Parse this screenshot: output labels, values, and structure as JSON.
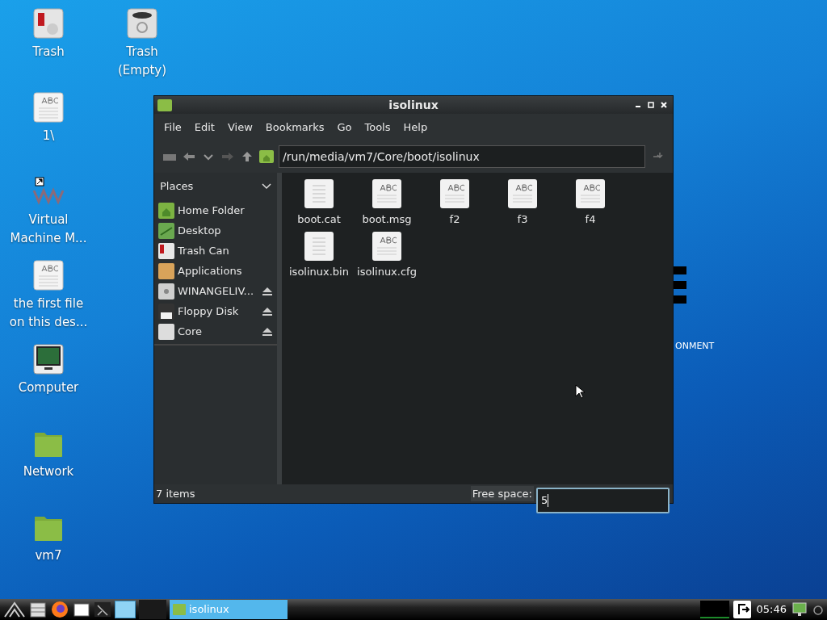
{
  "desktop_columns": [
    [
      {
        "label": "Trash",
        "kind": "trash-full"
      },
      {
        "label": "1\\",
        "kind": "text-file"
      },
      {
        "label": "Virtual\nMachine M...",
        "kind": "app"
      },
      {
        "label": "the first file\non this des...",
        "kind": "text-file"
      },
      {
        "label": "Computer",
        "kind": "computer"
      },
      {
        "label": "Network",
        "kind": "folder"
      },
      {
        "label": "vm7",
        "kind": "folder"
      }
    ],
    [
      {
        "label": "Trash\n(Empty)",
        "kind": "trash-empty"
      }
    ]
  ],
  "wallpaper_text": "ONMENT",
  "window": {
    "title": "isolinux",
    "menu": [
      "File",
      "Edit",
      "View",
      "Bookmarks",
      "Go",
      "Tools",
      "Help"
    ],
    "path": "/run/media/vm7/Core/boot/isolinux",
    "places_title": "Places",
    "places": [
      {
        "label": "Home Folder",
        "kind": "home",
        "eject": false
      },
      {
        "label": "Desktop",
        "kind": "desktop",
        "eject": false
      },
      {
        "label": "Trash Can",
        "kind": "trash",
        "eject": false
      },
      {
        "label": "Applications",
        "kind": "apps",
        "eject": false
      },
      {
        "label": "WINANGELIV...",
        "kind": "cd",
        "eject": true
      },
      {
        "label": "Floppy Disk",
        "kind": "floppy",
        "eject": true
      },
      {
        "label": "Core",
        "kind": "drive",
        "eject": true
      }
    ],
    "files": [
      {
        "name": "boot.cat",
        "kind": "binary"
      },
      {
        "name": "boot.msg",
        "kind": "text"
      },
      {
        "name": "f2",
        "kind": "text"
      },
      {
        "name": "f3",
        "kind": "text"
      },
      {
        "name": "f4",
        "kind": "text"
      },
      {
        "name": "isolinux.bin",
        "kind": "binary"
      },
      {
        "name": "isolinux.cfg",
        "kind": "text"
      }
    ],
    "status": "7 items",
    "free_space_label": "Free space:",
    "free_space_value": "5"
  },
  "taskbar": {
    "task": "isolinux",
    "clock": "05:46"
  }
}
